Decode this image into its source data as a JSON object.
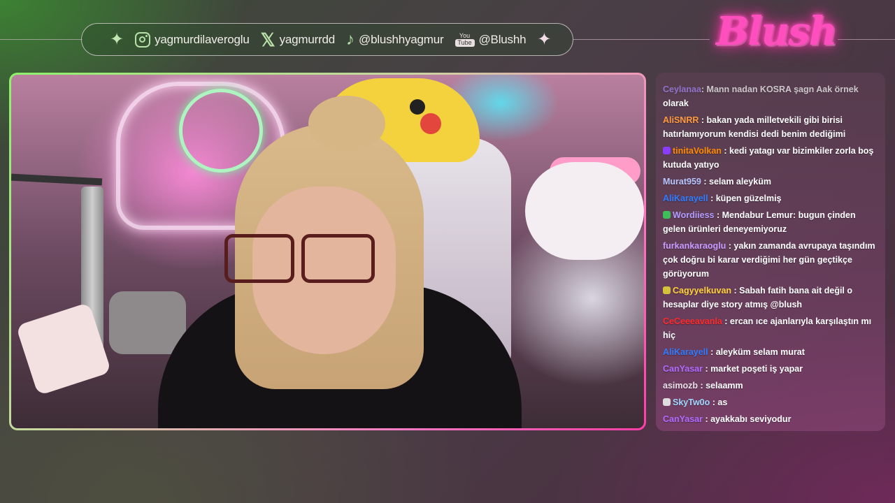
{
  "socials": {
    "instagram": "yagmurdilaveroglu",
    "x": "yagmurrdd",
    "tiktok": "@blushhyagmur",
    "youtube": "@Blushh",
    "youtube_icon_top": "You",
    "youtube_icon_box": "Tube"
  },
  "logo_text": "Blush",
  "chat": {
    "cut_message": {
      "user": "Ceylanaa",
      "text": ": Mann nadan KOSRA şagn Aak örnek",
      "continued": "olarak",
      "user_color": "#a98bff"
    },
    "messages": [
      {
        "user": "AliSNRR",
        "text": ": bakan yada milletvekili gibi birisi hatırlamıyorum kendisi dedi benim dediğimi",
        "user_color": "#ff9a3c",
        "badge": ""
      },
      {
        "user": "tinitaVolkan",
        "text": ": kedi yatagı var bizimkiler zorla boş kutuda yatıyo",
        "user_color": "#ff8a00",
        "badge": "#8a3cff"
      },
      {
        "user": "Murat959",
        "text": ": selam aleyküm",
        "user_color": "#b7c6ff",
        "badge": ""
      },
      {
        "user": "AliKarayell",
        "text": ": küpen güzelmiş",
        "user_color": "#2f7cff",
        "badge": ""
      },
      {
        "user": "Wordiiess",
        "text": ": Mendabur Lemur: bugun çinden gelen ürünleri deneyemiyoruz",
        "user_color": "#b19cff",
        "badge": "#3fbf5a"
      },
      {
        "user": "furkankaraoglu",
        "text": ": yakın zamanda avrupaya taşındım çok doğru bi karar verdiğimi her gün geçtikçe görüyorum",
        "user_color": "#c79bff",
        "badge": ""
      },
      {
        "user": "Cagyyelkuvan",
        "text": ": Sabah fatih bana ait değil o hesaplar diye story atmış @blush",
        "user_color": "#ffd23c",
        "badge": "#d4c23a"
      },
      {
        "user": "CeCeeeavanla",
        "text": ": ercan ıce ajanlarıyla karşılaştın mı hiç",
        "user_color": "#ff2a2a",
        "badge": ""
      },
      {
        "user": "AliKarayell",
        "text": ": aleyküm selam murat",
        "user_color": "#2f7cff",
        "badge": ""
      },
      {
        "user": "CanYasar",
        "text": ": market poşeti iş yapar",
        "user_color": "#b06bff",
        "badge": ""
      },
      {
        "user": "asimozb",
        "text": ": selaamm",
        "user_color": "#e8e0e8",
        "badge": ""
      },
      {
        "user": "SkyTw0o",
        "text": ": as",
        "user_color": "#9fd8ff",
        "badge": "#dddddd"
      },
      {
        "user": "CanYasar",
        "text": ": ayakkabı seviyodur",
        "user_color": "#b06bff",
        "badge": ""
      }
    ]
  }
}
